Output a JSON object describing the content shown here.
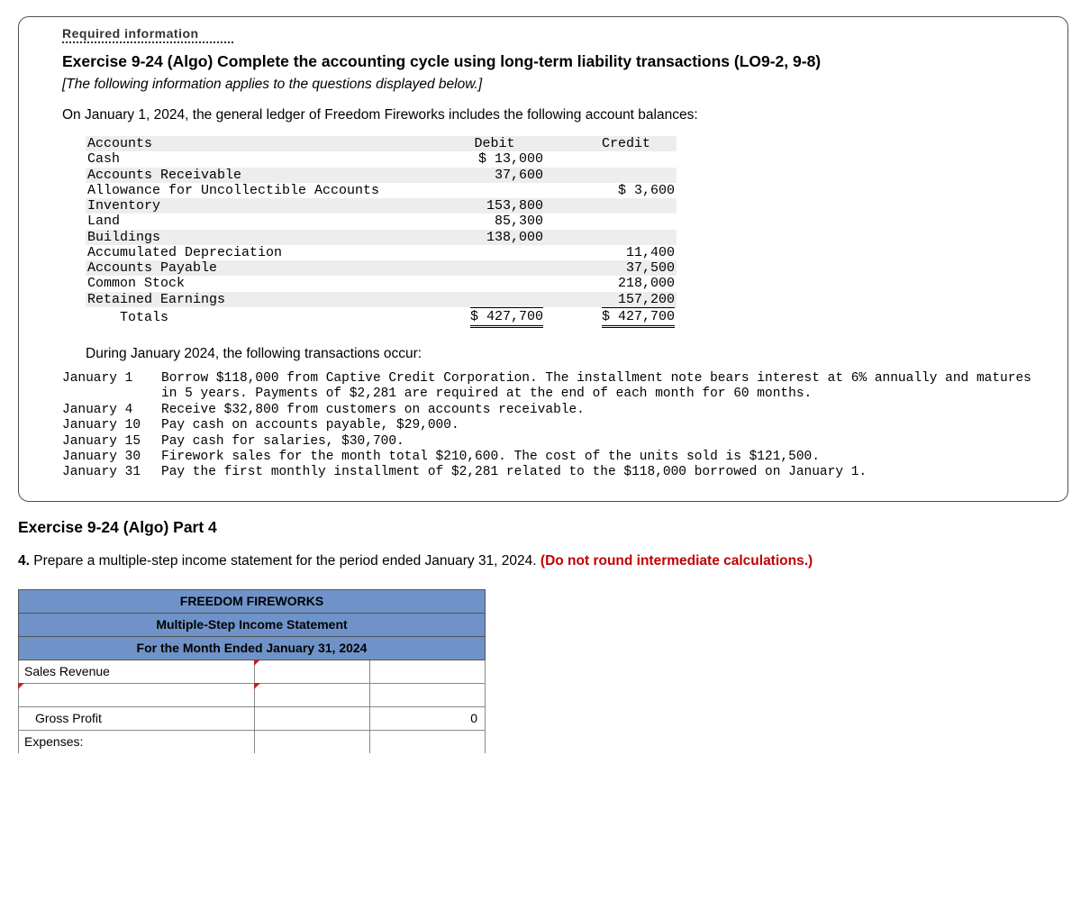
{
  "req_header": "Required information",
  "exercise_title": "Exercise 9-24 (Algo) Complete the accounting cycle using long-term liability transactions (LO9-2, 9-8)",
  "italic_note": "[The following information applies to the questions displayed below.]",
  "intro": "On January 1, 2024, the general ledger of Freedom Fireworks includes the following account balances:",
  "ledger_headers": {
    "accounts": "Accounts",
    "debit": "Debit",
    "credit": "Credit"
  },
  "ledger_rows": [
    {
      "name": "Cash",
      "debit": "$ 13,000",
      "credit": "",
      "shade": false
    },
    {
      "name": "Accounts Receivable",
      "debit": "37,600",
      "credit": "",
      "shade": true
    },
    {
      "name": "Allowance for Uncollectible Accounts",
      "debit": "",
      "credit": "$ 3,600",
      "shade": false
    },
    {
      "name": "Inventory",
      "debit": "153,800",
      "credit": "",
      "shade": true
    },
    {
      "name": "Land",
      "debit": "85,300",
      "credit": "",
      "shade": false
    },
    {
      "name": "Buildings",
      "debit": "138,000",
      "credit": "",
      "shade": true
    },
    {
      "name": "Accumulated Depreciation",
      "debit": "",
      "credit": "11,400",
      "shade": false
    },
    {
      "name": "Accounts Payable",
      "debit": "",
      "credit": "37,500",
      "shade": true
    },
    {
      "name": "Common Stock",
      "debit": "",
      "credit": "218,000",
      "shade": false
    },
    {
      "name": "Retained Earnings",
      "debit": "",
      "credit": "157,200",
      "shade": true
    }
  ],
  "ledger_totals": {
    "label": "Totals",
    "debit": "$ 427,700",
    "credit": "$ 427,700"
  },
  "during_text": "During January 2024, the following transactions occur:",
  "transactions": [
    {
      "date": "January 1",
      "desc": "Borrow $118,000 from Captive Credit Corporation. The installment note bears interest at 6% annually and matures in 5 years. Payments of $2,281 are required at the end of each month for 60 months."
    },
    {
      "date": "January 4",
      "desc": "Receive $32,800 from customers on accounts receivable."
    },
    {
      "date": "January 10",
      "desc": "Pay cash on accounts payable, $29,000."
    },
    {
      "date": "January 15",
      "desc": "Pay cash for salaries, $30,700."
    },
    {
      "date": "January 30",
      "desc": "Firework sales for the month total $210,600. The cost of the units sold is $121,500."
    },
    {
      "date": "January 31",
      "desc": "Pay the first monthly installment of $2,281 related to the $118,000 borrowed on January 1."
    }
  ],
  "part_title": "Exercise 9-24 (Algo) Part 4",
  "instruction_num": "4.",
  "instruction_text": "Prepare a multiple-step income statement for the period ended January 31, 2024.",
  "instruction_red": "(Do not round intermediate calculations.)",
  "stmt": {
    "h1": "FREEDOM FIREWORKS",
    "h2": "Multiple-Step Income Statement",
    "h3": "For the Month Ended January 31, 2024",
    "row1_label": "Sales Revenue",
    "row3_label": "Gross Profit",
    "row3_val": "0",
    "row4_label": "Expenses:"
  }
}
